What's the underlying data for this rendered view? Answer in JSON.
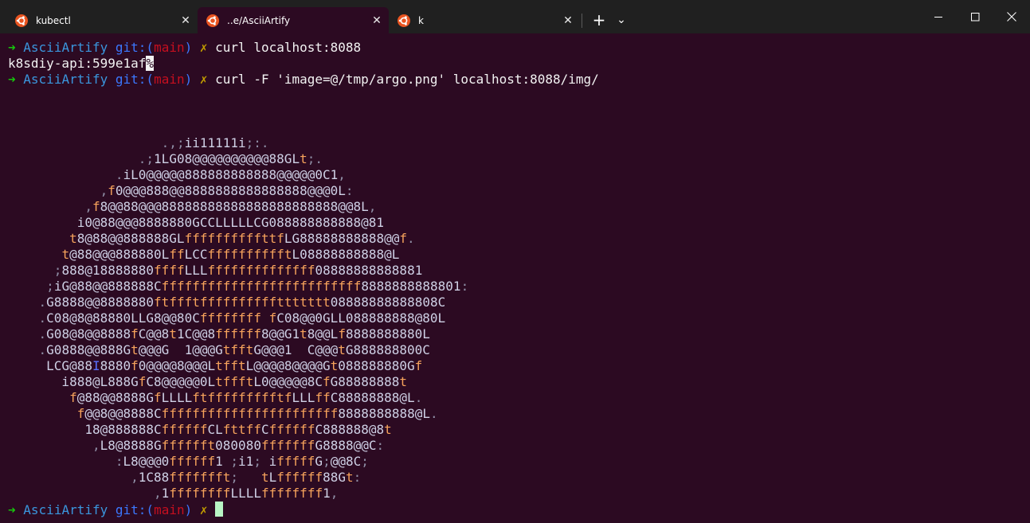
{
  "window": {
    "tabs": [
      {
        "label": "kubectl",
        "active": false
      },
      {
        "label": "..e/AsciiArtify",
        "active": true
      },
      {
        "label": "k",
        "active": false
      }
    ],
    "new_tab_symbol": "+",
    "dropdown_symbol": "⌄",
    "controls": {
      "minimize": "minimize-icon",
      "maximize": "maximize-icon",
      "close": "close-icon"
    }
  },
  "colors": {
    "background": "#2c0a22",
    "titlebar": "#202020",
    "prompt_arrow": "#16c60c",
    "prompt_dir": "#3a96dd",
    "prompt_git": "#3b78ff",
    "prompt_branch": "#c50f1f",
    "prompt_dirty": "#c19c00"
  },
  "terminal": {
    "prompt": {
      "arrow": "➜",
      "dir": "AsciiArtify",
      "git_open": "git:(",
      "branch": "main",
      "git_close": ")",
      "dirty": "✗"
    },
    "commands": [
      "curl localhost:8088",
      "curl -F 'image=@/tmp/argo.png' localhost:8088/img/"
    ],
    "output_line": "k8sdiy-api:599e1af",
    "output_cursor_char": "%",
    "ascii_art": [
      "                    .,;ii11111i;:.",
      "                 .;1LG08@@@@@@@@@@88GLt;.",
      "              .iL0@@@@@888888888888@@@@@0C1,",
      "            ,f0@@@888@@8888888888888888@@@0L:",
      "          ,f8@@88@@@88888888888888888888888@@8L,",
      "         i0@88@@@8888880GCCLLLLLCG088888888888@81",
      "        t8@88@@888888GLffffffffffttfLG88888888888@@f.",
      "       t@88@@@888880LffLCCfffffffffftL08888888888@L",
      "      ;888@18888880ffffLLLffffffffffffff08888888888881",
      "     ;iG@88@@888888Cffffffffffffffffffffffffff8888888888801:",
      "    .G8888@@8888880ftffftffffffffffttttttt08888888888808C",
      "    .C08@8@88880LLG8@@80Cffffffff fC08@@0GLL088888888@80L",
      "    .G08@8@@8888fC@@8t1C@@8ffffff8@@G1t8@@Lf8888888880L",
      "    .G0888@@888Gt@@@G  1@@@GtfftG@@@1  C@@@tG888888800C",
      "     LCG@88I8880f0@@@@8@@@LtfftL@@@@8@@@@Gt088888880Gf",
      "       i888@L888GfC8@@@@@0LtffftL0@@@@@8CfG88888888t",
      "        f@88@@8888GfLLLLftffffffffftfLLLffC88888888@L.",
      "         f@@8@@8888Cfffffffffffffffffffffff8888888888@L.",
      "          18@888888CffffffCLfttffCffffffC888888@8t",
      "           ,L8@8888Gfffffft080080fffffffG8888@@C:",
      "              :L8@@@0ffffff1 ;i1; ifffffG;@@8C;",
      "                ,1C88ffffffft;   tLffffff88Gt:",
      "                   ,1ffffffffLLLLffffffff1,"
    ]
  }
}
